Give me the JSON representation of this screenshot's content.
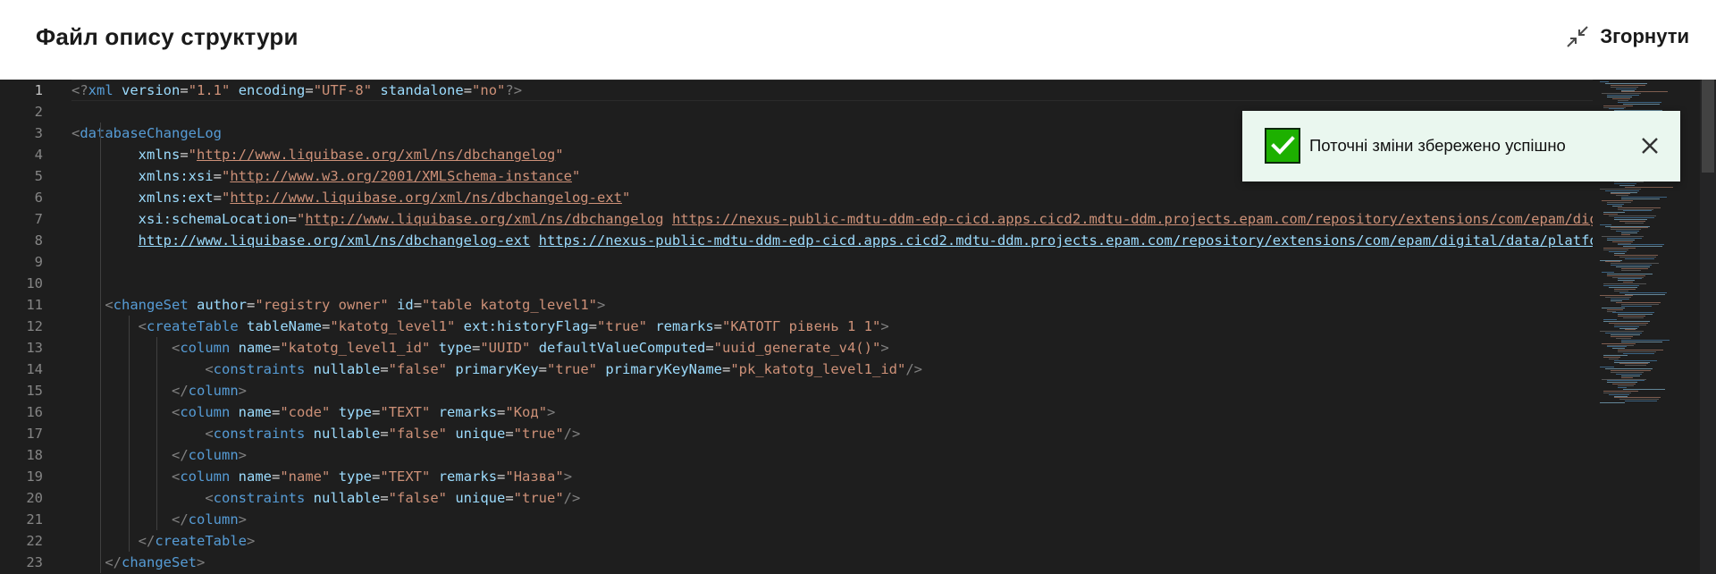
{
  "header": {
    "title": "Файл опису структури",
    "collapse_label": "Згорнути",
    "collapse_icon": "minimize-arrows-icon"
  },
  "toast": {
    "message": "Поточні зміни збережено успішно",
    "status_icon": "check-icon",
    "close_icon": "close-icon",
    "accent_color": "#1db000"
  },
  "editor": {
    "active_line": 1,
    "lines": [
      {
        "n": "1",
        "tokens": [
          [
            "p",
            "<?"
          ],
          [
            "t",
            "xml"
          ],
          [
            "x",
            " "
          ],
          [
            "a",
            "version"
          ],
          [
            "x",
            "="
          ],
          [
            "v",
            "\"1.1\""
          ],
          [
            "x",
            " "
          ],
          [
            "a",
            "encoding"
          ],
          [
            "x",
            "="
          ],
          [
            "v",
            "\"UTF-8\""
          ],
          [
            "x",
            " "
          ],
          [
            "a",
            "standalone"
          ],
          [
            "x",
            "="
          ],
          [
            "v",
            "\"no\""
          ],
          [
            "p",
            "?>"
          ]
        ]
      },
      {
        "n": "2",
        "tokens": []
      },
      {
        "n": "3",
        "tokens": [
          [
            "p",
            "<"
          ],
          [
            "t",
            "databaseChangeLog"
          ]
        ]
      },
      {
        "n": "4",
        "tokens": [
          [
            "x",
            "        "
          ],
          [
            "a",
            "xmlns"
          ],
          [
            "x",
            "="
          ],
          [
            "v",
            "\""
          ],
          [
            "u",
            "http://www.liquibase.org/xml/ns/dbchangelog"
          ],
          [
            "v",
            "\""
          ]
        ]
      },
      {
        "n": "5",
        "tokens": [
          [
            "x",
            "        "
          ],
          [
            "a",
            "xmlns:xsi"
          ],
          [
            "x",
            "="
          ],
          [
            "v",
            "\""
          ],
          [
            "u",
            "http://www.w3.org/2001/XMLSchema-instance"
          ],
          [
            "v",
            "\""
          ]
        ]
      },
      {
        "n": "6",
        "tokens": [
          [
            "x",
            "        "
          ],
          [
            "a",
            "xmlns:ext"
          ],
          [
            "x",
            "="
          ],
          [
            "v",
            "\""
          ],
          [
            "u",
            "http://www.liquibase.org/xml/ns/dbchangelog-ext"
          ],
          [
            "v",
            "\""
          ]
        ]
      },
      {
        "n": "7",
        "tokens": [
          [
            "x",
            "        "
          ],
          [
            "a",
            "xsi:schemaLocation"
          ],
          [
            "x",
            "="
          ],
          [
            "v",
            "\""
          ],
          [
            "u",
            "http://www.liquibase.org/xml/ns/dbchangelog"
          ],
          [
            "x",
            " "
          ],
          [
            "u",
            "https://nexus-public-mdtu-ddm-edp-cicd.apps.cicd2.mdtu-ddm.projects.epam.com/repository/extensions/com/epam/digital/data/platform/liquibase-ext-schema/latest/liquibase-ext-schema-latest.xsd"
          ]
        ]
      },
      {
        "n": "8",
        "tokens": [
          [
            "x",
            "        "
          ],
          [
            "w",
            "http://www.liquibase.org/xml/ns/dbchangelog-ext"
          ],
          [
            "x",
            " "
          ],
          [
            "w",
            "https://nexus-public-mdtu-ddm-edp-cicd.apps.cicd2.mdtu-ddm.projects.epam.com/repository/extensions/com/epam/digital/data/platform/liquibase-ext-schema/latest/liquibase-ext-schema-latest.xsd"
          ]
        ]
      },
      {
        "n": "9",
        "tokens": []
      },
      {
        "n": "10",
        "tokens": []
      },
      {
        "n": "11",
        "tokens": [
          [
            "x",
            "    "
          ],
          [
            "p",
            "<"
          ],
          [
            "t",
            "changeSet"
          ],
          [
            "x",
            " "
          ],
          [
            "a",
            "author"
          ],
          [
            "x",
            "="
          ],
          [
            "v",
            "\"registry owner\""
          ],
          [
            "x",
            " "
          ],
          [
            "a",
            "id"
          ],
          [
            "x",
            "="
          ],
          [
            "v",
            "\"table katotg_level1\""
          ],
          [
            "p",
            ">"
          ]
        ]
      },
      {
        "n": "12",
        "tokens": [
          [
            "x",
            "        "
          ],
          [
            "p",
            "<"
          ],
          [
            "t",
            "createTable"
          ],
          [
            "x",
            " "
          ],
          [
            "a",
            "tableName"
          ],
          [
            "x",
            "="
          ],
          [
            "v",
            "\"katotg_level1\""
          ],
          [
            "x",
            " "
          ],
          [
            "a",
            "ext:historyFlag"
          ],
          [
            "x",
            "="
          ],
          [
            "v",
            "\"true\""
          ],
          [
            "x",
            " "
          ],
          [
            "a",
            "remarks"
          ],
          [
            "x",
            "="
          ],
          [
            "v",
            "\"КАТОТГ рівень 1 1\""
          ],
          [
            "p",
            ">"
          ]
        ]
      },
      {
        "n": "13",
        "tokens": [
          [
            "x",
            "            "
          ],
          [
            "p",
            "<"
          ],
          [
            "t",
            "column"
          ],
          [
            "x",
            " "
          ],
          [
            "a",
            "name"
          ],
          [
            "x",
            "="
          ],
          [
            "v",
            "\"katotg_level1_id\""
          ],
          [
            "x",
            " "
          ],
          [
            "a",
            "type"
          ],
          [
            "x",
            "="
          ],
          [
            "v",
            "\"UUID\""
          ],
          [
            "x",
            " "
          ],
          [
            "a",
            "defaultValueComputed"
          ],
          [
            "x",
            "="
          ],
          [
            "v",
            "\"uuid_generate_v4()\""
          ],
          [
            "p",
            ">"
          ]
        ]
      },
      {
        "n": "14",
        "tokens": [
          [
            "x",
            "                "
          ],
          [
            "p",
            "<"
          ],
          [
            "t",
            "constraints"
          ],
          [
            "x",
            " "
          ],
          [
            "a",
            "nullable"
          ],
          [
            "x",
            "="
          ],
          [
            "v",
            "\"false\""
          ],
          [
            "x",
            " "
          ],
          [
            "a",
            "primaryKey"
          ],
          [
            "x",
            "="
          ],
          [
            "v",
            "\"true\""
          ],
          [
            "x",
            " "
          ],
          [
            "a",
            "primaryKeyName"
          ],
          [
            "x",
            "="
          ],
          [
            "v",
            "\"pk_katotg_level1_id\""
          ],
          [
            "p",
            "/>"
          ]
        ]
      },
      {
        "n": "15",
        "tokens": [
          [
            "x",
            "            "
          ],
          [
            "p",
            "</"
          ],
          [
            "t",
            "column"
          ],
          [
            "p",
            ">"
          ]
        ]
      },
      {
        "n": "16",
        "tokens": [
          [
            "x",
            "            "
          ],
          [
            "p",
            "<"
          ],
          [
            "t",
            "column"
          ],
          [
            "x",
            " "
          ],
          [
            "a",
            "name"
          ],
          [
            "x",
            "="
          ],
          [
            "v",
            "\"code\""
          ],
          [
            "x",
            " "
          ],
          [
            "a",
            "type"
          ],
          [
            "x",
            "="
          ],
          [
            "v",
            "\"TEXT\""
          ],
          [
            "x",
            " "
          ],
          [
            "a",
            "remarks"
          ],
          [
            "x",
            "="
          ],
          [
            "v",
            "\"Код\""
          ],
          [
            "p",
            ">"
          ]
        ]
      },
      {
        "n": "17",
        "tokens": [
          [
            "x",
            "                "
          ],
          [
            "p",
            "<"
          ],
          [
            "t",
            "constraints"
          ],
          [
            "x",
            " "
          ],
          [
            "a",
            "nullable"
          ],
          [
            "x",
            "="
          ],
          [
            "v",
            "\"false\""
          ],
          [
            "x",
            " "
          ],
          [
            "a",
            "unique"
          ],
          [
            "x",
            "="
          ],
          [
            "v",
            "\"true\""
          ],
          [
            "p",
            "/>"
          ]
        ]
      },
      {
        "n": "18",
        "tokens": [
          [
            "x",
            "            "
          ],
          [
            "p",
            "</"
          ],
          [
            "t",
            "column"
          ],
          [
            "p",
            ">"
          ]
        ]
      },
      {
        "n": "19",
        "tokens": [
          [
            "x",
            "            "
          ],
          [
            "p",
            "<"
          ],
          [
            "t",
            "column"
          ],
          [
            "x",
            " "
          ],
          [
            "a",
            "name"
          ],
          [
            "x",
            "="
          ],
          [
            "v",
            "\"name\""
          ],
          [
            "x",
            " "
          ],
          [
            "a",
            "type"
          ],
          [
            "x",
            "="
          ],
          [
            "v",
            "\"TEXT\""
          ],
          [
            "x",
            " "
          ],
          [
            "a",
            "remarks"
          ],
          [
            "x",
            "="
          ],
          [
            "v",
            "\"Назва\""
          ],
          [
            "p",
            ">"
          ]
        ]
      },
      {
        "n": "20",
        "tokens": [
          [
            "x",
            "                "
          ],
          [
            "p",
            "<"
          ],
          [
            "t",
            "constraints"
          ],
          [
            "x",
            " "
          ],
          [
            "a",
            "nullable"
          ],
          [
            "x",
            "="
          ],
          [
            "v",
            "\"false\""
          ],
          [
            "x",
            " "
          ],
          [
            "a",
            "unique"
          ],
          [
            "x",
            "="
          ],
          [
            "v",
            "\"true\""
          ],
          [
            "p",
            "/>"
          ]
        ]
      },
      {
        "n": "21",
        "tokens": [
          [
            "x",
            "            "
          ],
          [
            "p",
            "</"
          ],
          [
            "t",
            "column"
          ],
          [
            "p",
            ">"
          ]
        ]
      },
      {
        "n": "22",
        "tokens": [
          [
            "x",
            "        "
          ],
          [
            "p",
            "</"
          ],
          [
            "t",
            "createTable"
          ],
          [
            "p",
            ">"
          ]
        ]
      },
      {
        "n": "23",
        "tokens": [
          [
            "x",
            "    "
          ],
          [
            "p",
            "</"
          ],
          [
            "t",
            "changeSet"
          ],
          [
            "p",
            ">"
          ]
        ]
      }
    ]
  }
}
